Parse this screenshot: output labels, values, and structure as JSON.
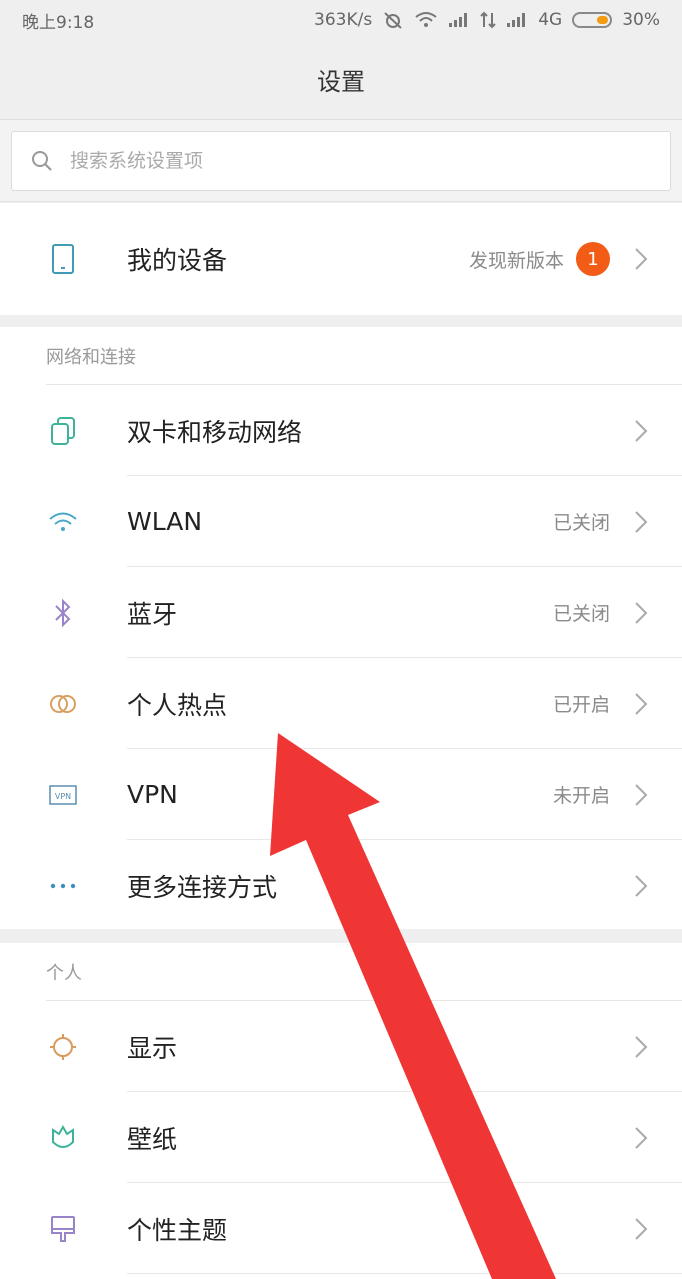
{
  "status_bar": {
    "time": "晚上9:18",
    "speed": "363K/s",
    "network": "4G",
    "battery": "30%",
    "battery_level": 0.3
  },
  "header": {
    "title": "设置"
  },
  "search": {
    "placeholder": "搜索系统设置项"
  },
  "device": {
    "label": "我的设备",
    "status": "发现新版本",
    "badge": "1"
  },
  "network_section": {
    "title": "网络和连接",
    "items": [
      {
        "label": "双卡和移动网络",
        "value": "",
        "icon": "dual-sim-icon"
      },
      {
        "label": "WLAN",
        "value": "已关闭",
        "icon": "wifi-icon"
      },
      {
        "label": "蓝牙",
        "value": "已关闭",
        "icon": "bluetooth-icon"
      },
      {
        "label": "个人热点",
        "value": "已开启",
        "icon": "hotspot-icon"
      },
      {
        "label": "VPN",
        "value": "未开启",
        "icon": "vpn-icon"
      },
      {
        "label": "更多连接方式",
        "value": "",
        "icon": "more-dots-icon"
      }
    ]
  },
  "personal_section": {
    "title": "个人",
    "items": [
      {
        "label": "显示",
        "icon": "display-icon"
      },
      {
        "label": "壁纸",
        "icon": "wallpaper-icon"
      },
      {
        "label": "个性主题",
        "icon": "theme-icon"
      }
    ]
  },
  "vpn_icon_text": "VPN",
  "colors": {
    "accent_badge": "#f25c16",
    "annotation_arrow": "#f03535"
  }
}
